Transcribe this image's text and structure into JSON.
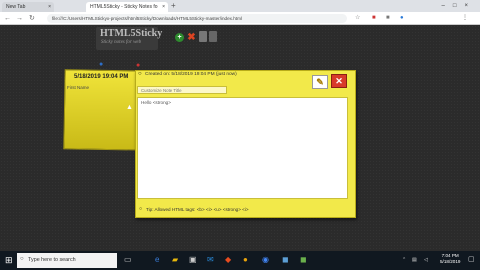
{
  "browser": {
    "tabs": [
      {
        "label": "New Tab"
      },
      {
        "label": "HTML5Sticky - Sticky Notes fo"
      }
    ],
    "new_tab_glyph": "+",
    "address": "file:///C:/Users/HTMLStickyx-projects/html5Sticky/Downloads/HTML5Sticky-master/index.html",
    "nav_back": "←",
    "nav_forward": "→",
    "nav_reload": "↻"
  },
  "app": {
    "logo_title": "HTML5Sticky",
    "logo_sub": "Sticky notes for web"
  },
  "note": {
    "date": "5/18/2019 19:04 PM",
    "text": "First Name"
  },
  "dialog": {
    "created_label": "Created on: 5/18/2019 19:04 PM (just now)",
    "title_placeholder": "Customize Note Title",
    "content": "Hello <strong>",
    "tip": "Tip: Allowed HTML tags: <b> <i> <u> <strong> <i>"
  },
  "taskbar": {
    "search_placeholder": "Type here to search",
    "time": "7:04 PM",
    "date": "5/18/2019"
  },
  "colors": {
    "note_yellow": "#f0e43a",
    "dialog_yellow": "#f2e94a",
    "close_red": "#d83a2a",
    "add_green": "#2e8b2e"
  },
  "icons": [
    "back-icon",
    "forward-icon",
    "reload-icon",
    "star-icon",
    "add-note-icon",
    "delete-all-icon",
    "save-icon",
    "close-icon",
    "edit-icon",
    "pin-icon",
    "windows-icon",
    "search-icon"
  ]
}
